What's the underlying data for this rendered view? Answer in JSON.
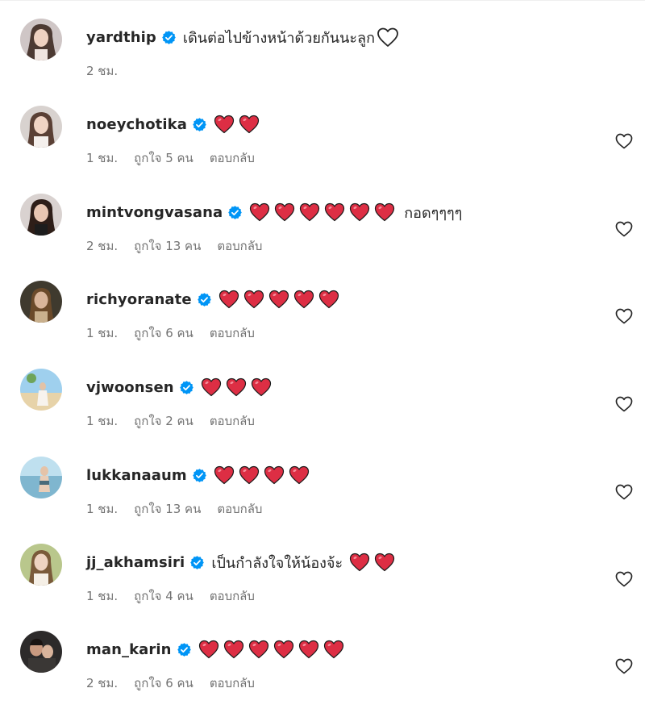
{
  "comments": [
    {
      "username": "yardthip",
      "text_before": "เดินต่อไปข้างหน้าด้วยกันนะลูก",
      "hearts": 0,
      "text_after": "",
      "outline_heart": true,
      "time": "2 ชม.",
      "likes": "",
      "reply": "",
      "show_like_button": false
    },
    {
      "username": "noeychotika",
      "text_before": "",
      "hearts": 2,
      "text_after": "",
      "outline_heart": false,
      "time": "1 ชม.",
      "likes": "ถูกใจ 5 คน",
      "reply": "ตอบกลับ",
      "show_like_button": true
    },
    {
      "username": "mintvongvasana",
      "text_before": "",
      "hearts": 6,
      "text_after": "กอดๆๆๆๆ",
      "outline_heart": false,
      "time": "2 ชม.",
      "likes": "ถูกใจ 13 คน",
      "reply": "ตอบกลับ",
      "show_like_button": true
    },
    {
      "username": "richyoranate",
      "text_before": "",
      "hearts": 5,
      "text_after": "",
      "outline_heart": false,
      "time": "1 ชม.",
      "likes": "ถูกใจ 6 คน",
      "reply": "ตอบกลับ",
      "show_like_button": true
    },
    {
      "username": "vjwoonsen",
      "text_before": "",
      "hearts": 3,
      "text_after": "",
      "outline_heart": false,
      "time": "1 ชม.",
      "likes": "ถูกใจ 2 คน",
      "reply": "ตอบกลับ",
      "show_like_button": true
    },
    {
      "username": "lukkanaaum",
      "text_before": "",
      "hearts": 4,
      "text_after": "",
      "outline_heart": false,
      "time": "1 ชม.",
      "likes": "ถูกใจ 13 คน",
      "reply": "ตอบกลับ",
      "show_like_button": true
    },
    {
      "username": "jj_akhamsiri",
      "text_before": "เป็นกำลังใจให้น้องจ้ะ",
      "hearts": 2,
      "text_after": "",
      "outline_heart": false,
      "time": "1 ชม.",
      "likes": "ถูกใจ 4 คน",
      "reply": "ตอบกลับ",
      "show_like_button": true
    },
    {
      "username": "man_karin",
      "text_before": "",
      "hearts": 6,
      "text_after": "",
      "outline_heart": false,
      "time": "2 ชม.",
      "likes": "ถูกใจ 6 คน",
      "reply": "ตอบกลับ",
      "show_like_button": true
    }
  ],
  "colors": {
    "username": "#262626",
    "meta": "#737373",
    "verified_badge": "#0095f6",
    "heart_emoji": "#dd2e44",
    "like_icon": "#262626",
    "separator": "#efefef"
  },
  "icons": {
    "verified": "verified-badge-icon",
    "heart_emoji": "red-heart-emoji",
    "outline_heart": "white-heart-emoji",
    "like": "heart-outline-icon"
  }
}
